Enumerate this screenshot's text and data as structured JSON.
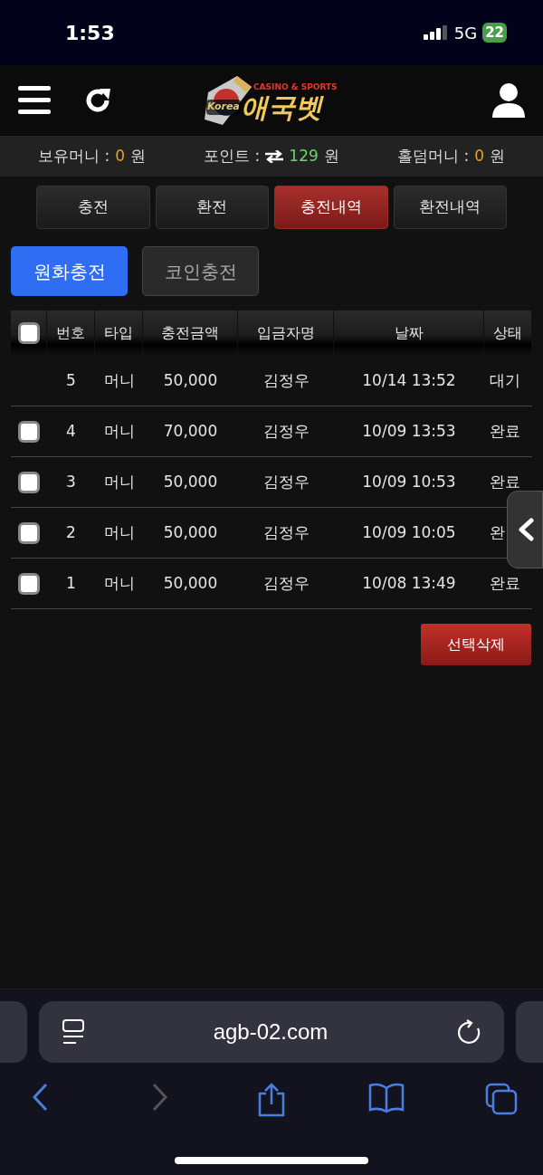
{
  "status_bar": {
    "time": "1:53",
    "network": "5G",
    "battery": "22"
  },
  "header": {
    "logo": {
      "emblem_text": "Korea",
      "tagline": "CASINO & SPORTS",
      "name": "애국벳"
    }
  },
  "balances": [
    {
      "label": "보유머니 :",
      "value": "0",
      "unit": "원",
      "kind": "money"
    },
    {
      "label": "포인트 :",
      "value": "129",
      "unit": "원",
      "kind": "point"
    },
    {
      "label": "홀덤머니 :",
      "value": "0",
      "unit": "원",
      "kind": "money"
    }
  ],
  "tabs": [
    {
      "label": "충전",
      "selected": false
    },
    {
      "label": "환전",
      "selected": false
    },
    {
      "label": "충전내역",
      "selected": true
    },
    {
      "label": "환전내역",
      "selected": false
    }
  ],
  "subtabs": [
    {
      "label": "원화충전",
      "selected": true
    },
    {
      "label": "코인충전",
      "selected": false
    }
  ],
  "table": {
    "header_checked": false,
    "columns": [
      "번호",
      "타입",
      "충전금액",
      "입금자명",
      "날짜",
      "상태"
    ],
    "rows": [
      {
        "cells": [
          "5",
          "머니",
          "50,000",
          "김정우",
          "10/14 13:52",
          "대기"
        ]
      },
      {
        "checked": false,
        "cells": [
          "4",
          "머니",
          "70,000",
          "김정우",
          "10/09 13:53",
          "완료"
        ]
      },
      {
        "checked": false,
        "cells": [
          "3",
          "머니",
          "50,000",
          "김정우",
          "10/09 10:53",
          "완료"
        ]
      },
      {
        "checked": false,
        "cells": [
          "2",
          "머니",
          "50,000",
          "김정우",
          "10/09 10:05",
          "완"
        ]
      },
      {
        "checked": false,
        "cells": [
          "1",
          "머니",
          "50,000",
          "김정우",
          "10/08 13:49",
          "완료"
        ]
      }
    ]
  },
  "delete_button": "선택삭제",
  "browser": {
    "url": "agb-02.com"
  }
}
